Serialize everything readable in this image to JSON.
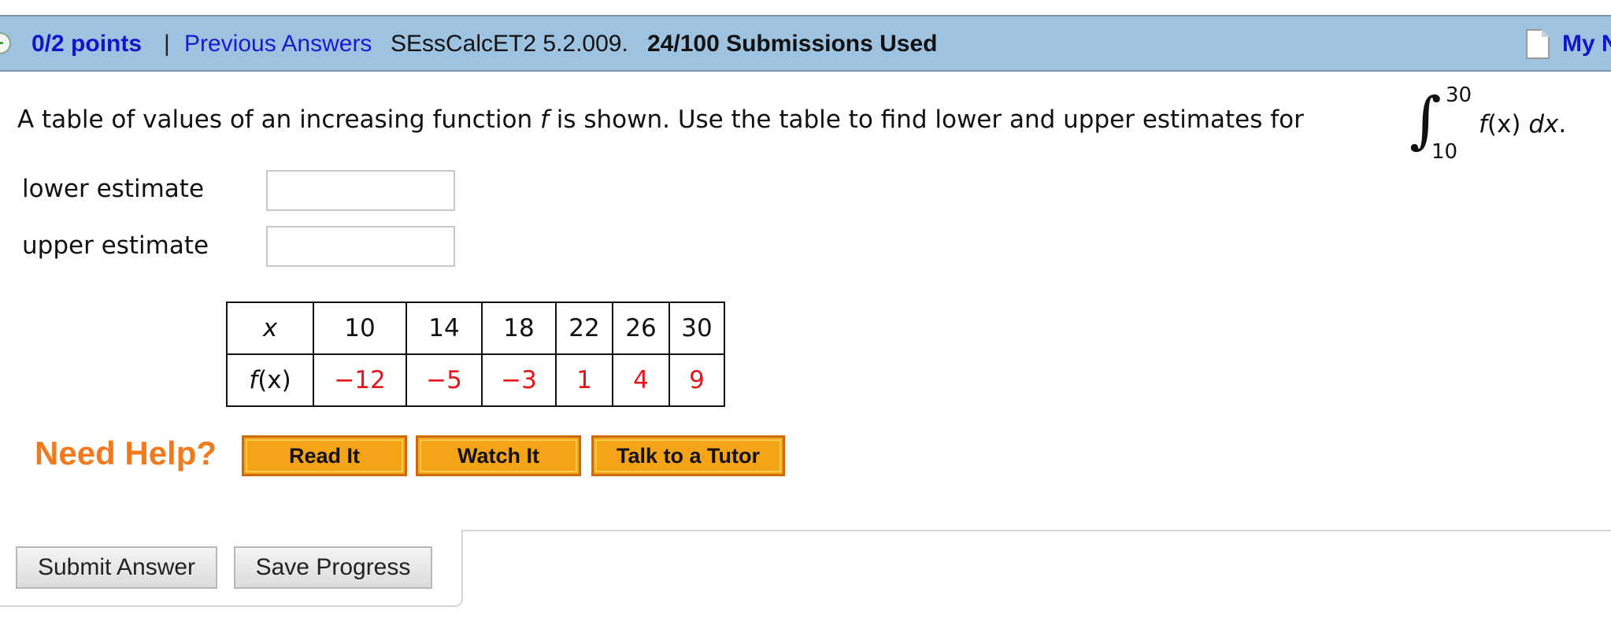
{
  "header": {
    "points": "0/2 points",
    "separator": "|",
    "previous_answers": "Previous Answers",
    "question_id": "SEssCalcET2 5.2.009.",
    "submissions": "24/100 Submissions Used",
    "my_notes": "My N"
  },
  "question": {
    "text_before": "A table of values of an increasing function ",
    "func": "f",
    "text_after": " is shown. Use the table to find lower and upper estimates for",
    "integral": {
      "upper": "30",
      "lower": "10",
      "fx": "f",
      "arg": "(x) ",
      "dx": "dx",
      "period": "."
    }
  },
  "fields": {
    "lower_label": "lower estimate",
    "lower_value": "",
    "upper_label": "upper estimate",
    "upper_value": ""
  },
  "table": {
    "x_header": "x",
    "fx_header_f": "f",
    "fx_header_rest": "(x)",
    "x_values": [
      "10",
      "14",
      "18",
      "22",
      "26",
      "30"
    ],
    "fx_values": [
      "−12",
      "−5",
      "−3",
      "1",
      "4",
      "9"
    ],
    "value_color": "#e8141a"
  },
  "help": {
    "label": "Need Help?",
    "read": "Read It",
    "watch": "Watch It",
    "tutor": "Talk to a Tutor"
  },
  "actions": {
    "submit": "Submit Answer",
    "save": "Save Progress"
  },
  "colors": {
    "header_bg": "#9ec3e1",
    "link": "#1414c8",
    "help_orange": "#f37a1c",
    "button_orange": "#f6a417"
  }
}
